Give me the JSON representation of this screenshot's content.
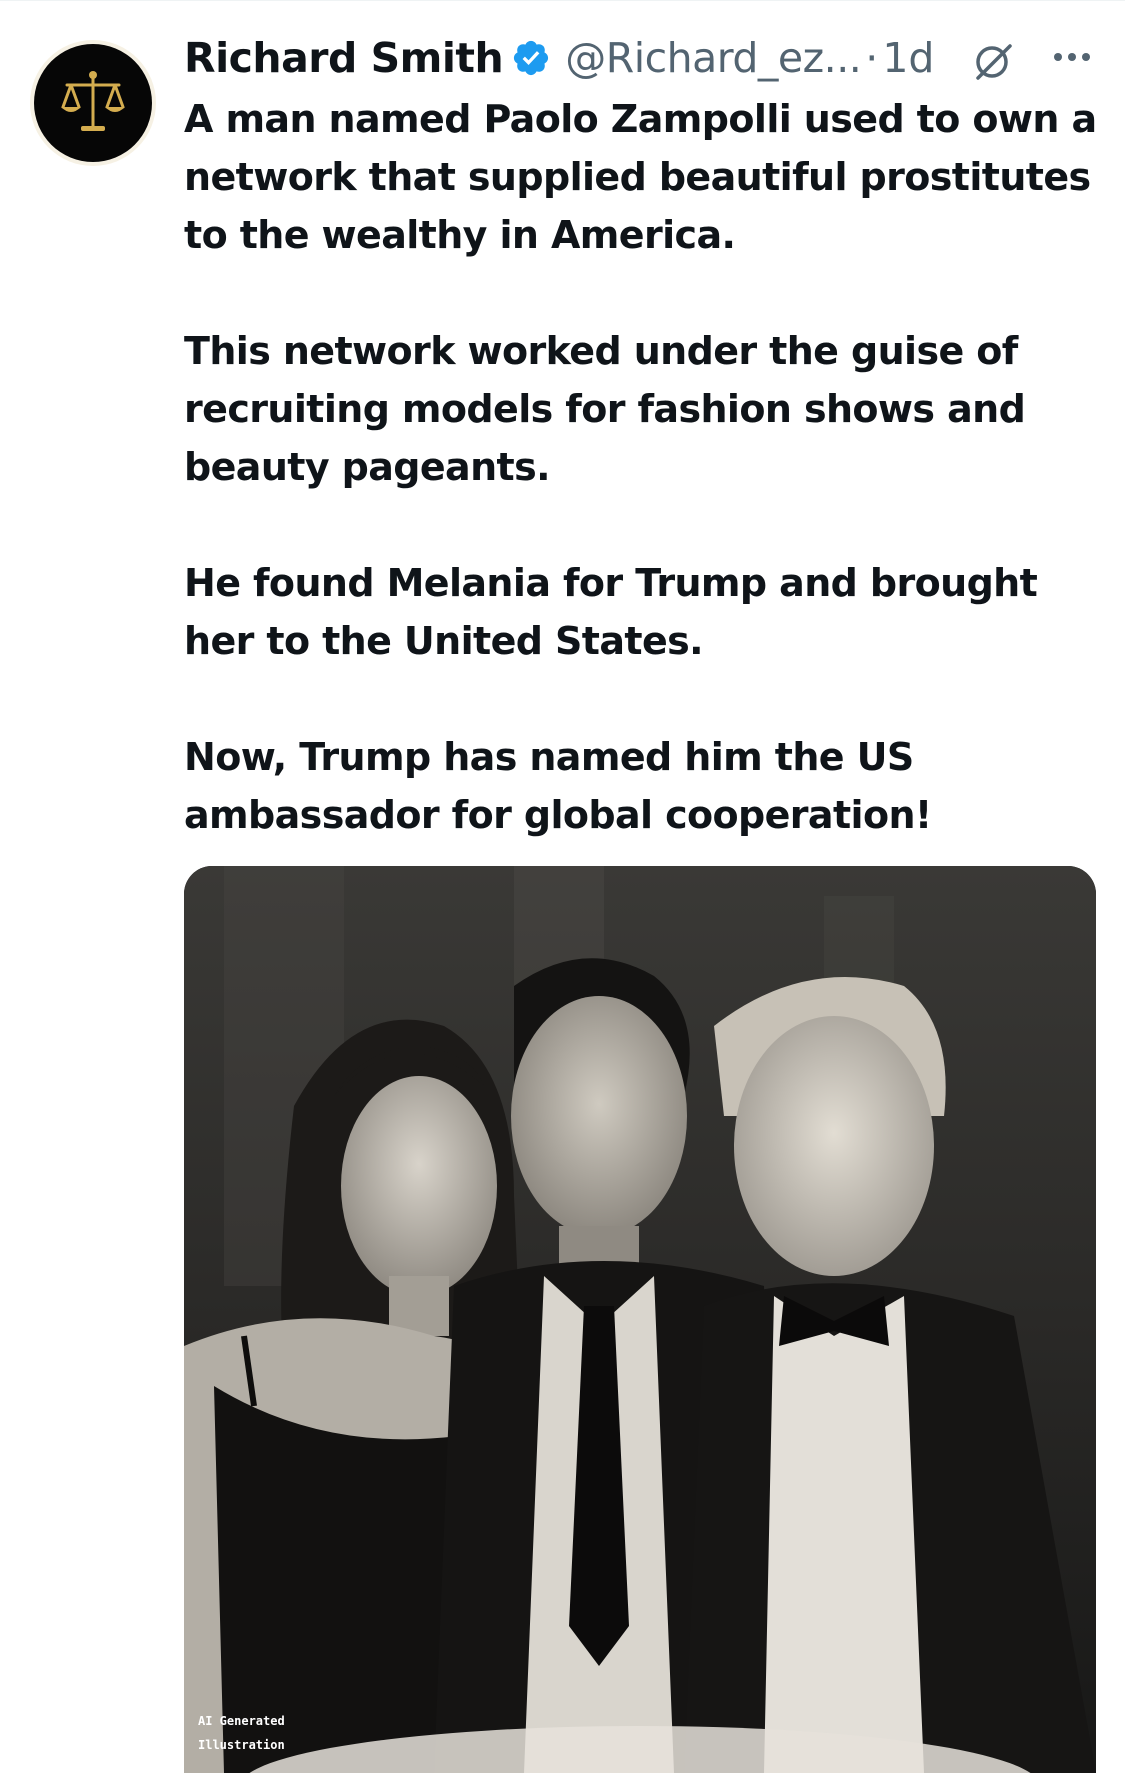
{
  "tweet": {
    "author": {
      "display_name": "Richard Smith",
      "handle": "@Richard_ez...",
      "verified": true,
      "avatar_icon": "scales-of-justice-icon"
    },
    "separator": "·",
    "time": "1d",
    "icons": {
      "grok": "grok-icon",
      "more": "more-icon",
      "verified": "verified-badge-icon"
    },
    "paragraphs": [
      "A man named Paolo Zampolli used to own a network that supplied beautiful prostitutes to the wealthy in America.",
      "This network worked under the guise of recruiting models for fashion shows and beauty pageants.",
      "He found Melania for Trump and brought her to the United States.",
      "Now, Trump has named him the US ambassador for global cooperation!"
    ],
    "media": {
      "type": "black-and-white photo of three people",
      "label_line1": "AI Generated",
      "label_line2": "Illustration"
    }
  },
  "colors": {
    "text_primary": "#0f1419",
    "text_secondary": "#536471",
    "verified_blue": "#1d9bf0",
    "background": "#ffffff",
    "avatar_gold": "#c9a24a"
  }
}
